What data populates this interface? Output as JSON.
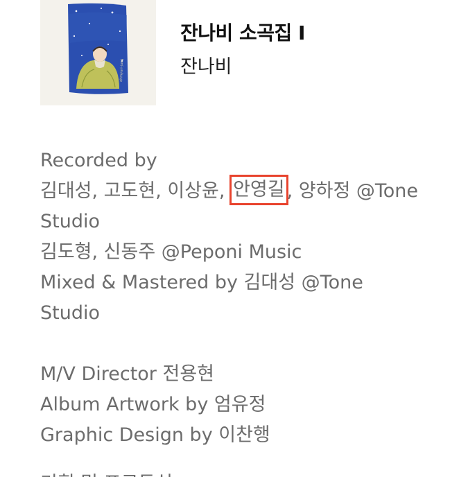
{
  "album": {
    "title": "잔나비 소곡집 I",
    "artist": "잔나비",
    "artwork_signature": "ehmyuri-jung"
  },
  "credits": {
    "recorded_label": "Recorded by",
    "recorded_names_before": "김대성, 고도현, 이상윤,",
    "recorded_highlight": "안영길",
    "recorded_names_after": ", 양하정 @Tone",
    "recorded_studio": "Studio",
    "recorded_second": "김도형, 신동주 @Peponi Music",
    "mixed_line": "Mixed & Mastered by 김대성 @Tone",
    "mixed_studio": "Studio",
    "mv_director": "M/V Director 전용현",
    "album_artwork": "Album Artwork by 엄유정",
    "graphic_design": "Graphic Design by 이찬행",
    "partial_next_line": "기획 및 프로듀싱"
  },
  "colors": {
    "highlight_border": "#e8432d",
    "credit_text": "#6c6c6c",
    "title_text": "#111111"
  }
}
